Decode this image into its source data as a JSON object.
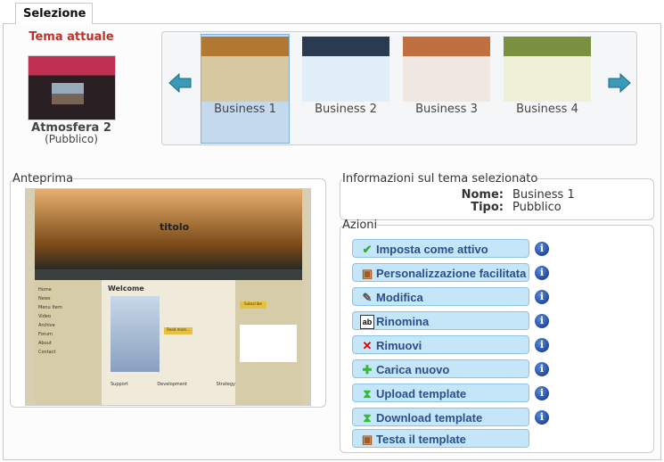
{
  "tabs": [
    {
      "label": "Selezione",
      "active": true
    }
  ],
  "current_theme": {
    "heading": "Tema attuale",
    "name": "Atmosfera 2",
    "type": "(Pubblico)"
  },
  "carousel": {
    "items": [
      {
        "label": "Business 1",
        "selected": true,
        "colors": [
          "#b07830",
          "#d8c8a0"
        ]
      },
      {
        "label": "Business 2",
        "selected": false,
        "colors": [
          "#2a3a50",
          "#e0eef8"
        ]
      },
      {
        "label": "Business 3",
        "selected": false,
        "colors": [
          "#c07040",
          "#f0e8e0"
        ]
      },
      {
        "label": "Business 4",
        "selected": false,
        "colors": [
          "#7a9040",
          "#eef0d8"
        ]
      }
    ],
    "prev_icon": "arrow-left-icon",
    "next_icon": "arrow-right-icon"
  },
  "preview": {
    "legend": "Anteprima",
    "site_title": "titolo",
    "welcome": "Welcome",
    "nav": [
      "Home",
      "News",
      "Menu Item",
      "Video",
      "Archive",
      "Forum",
      "About",
      "Contact"
    ],
    "sections": [
      "Support",
      "Development",
      "Strategy"
    ],
    "read_more": "Read more...",
    "subscribe": "Subscribe"
  },
  "info": {
    "legend": "Informazioni sul tema selezionato",
    "name_label": "Nome:",
    "name_value": "Business 1",
    "type_label": "Tipo:",
    "type_value": "Pubblico"
  },
  "actions": {
    "legend": "Azioni",
    "buttons": [
      {
        "label": "Imposta come attivo",
        "icon": "check-icon",
        "info": true
      },
      {
        "label": "Personalizzazione facilitata",
        "icon": "paint-icon",
        "info": true
      },
      {
        "label": "Modifica",
        "icon": "pencil-icon",
        "info": true
      },
      {
        "label": "Rinomina",
        "icon": "rename-icon",
        "info": true
      },
      {
        "label": "Rimuovi",
        "icon": "delete-icon",
        "info": true
      },
      {
        "label": "Carica nuovo",
        "icon": "plus-icon",
        "info": true
      },
      {
        "label": "Upload template",
        "icon": "upload-icon",
        "info": true
      },
      {
        "label": "Download template",
        "icon": "download-icon",
        "info": true
      },
      {
        "label": "Testa il template",
        "icon": "paint-icon",
        "info": false
      }
    ]
  },
  "colors": {
    "accent": "#c0302a",
    "button_bg": "#c5e6f8",
    "button_text": "#2a4f8a",
    "selected_bg": "#c5d9ed"
  }
}
